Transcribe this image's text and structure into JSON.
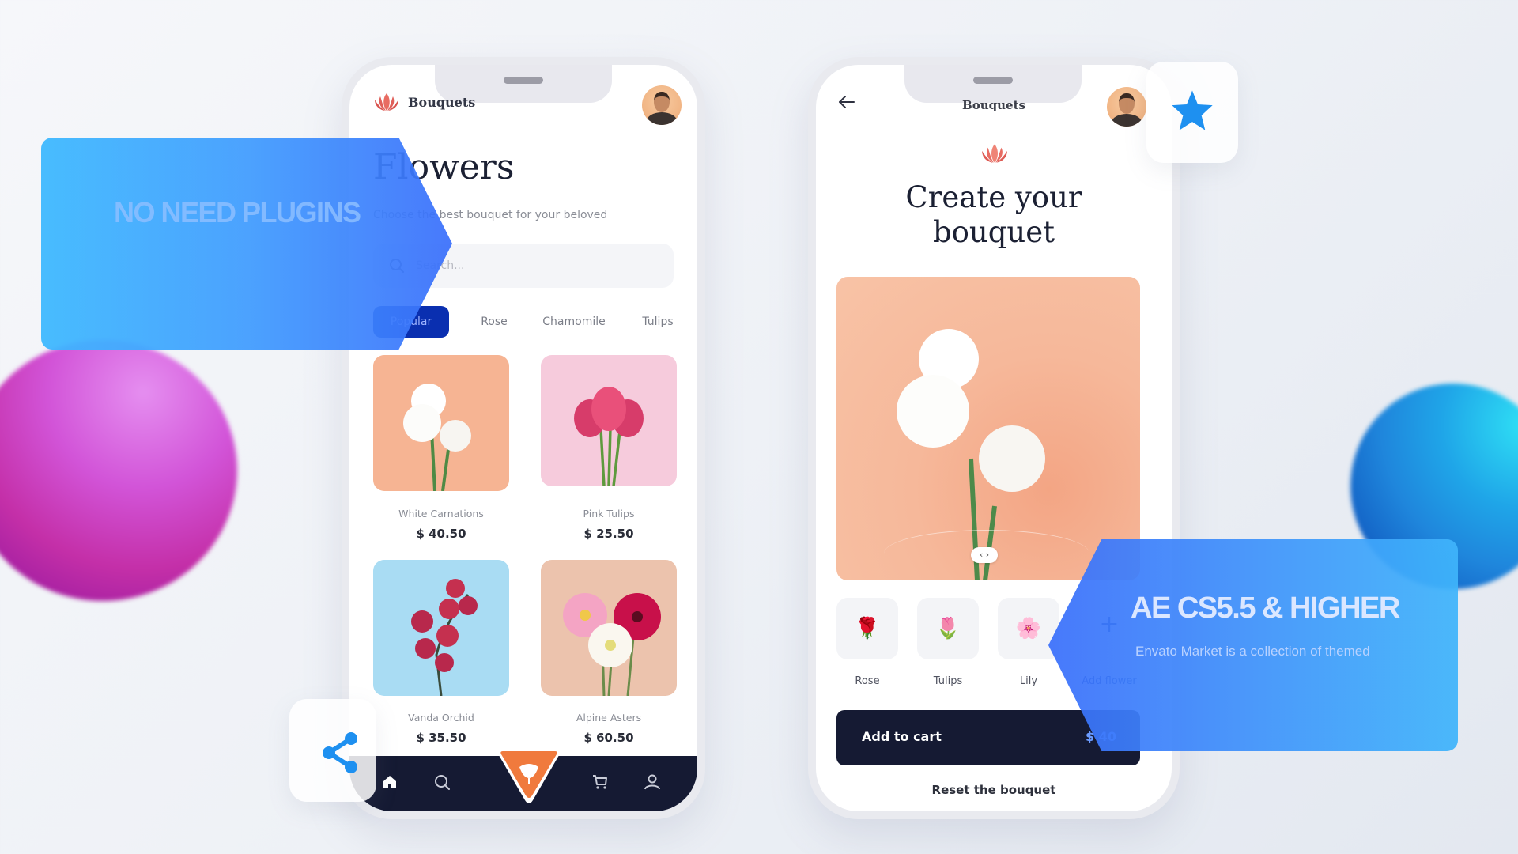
{
  "promo": {
    "left_banner": "NO NEED PLUGINS",
    "right_banner_title": "AE CS5.5 & HIGHER",
    "right_banner_subtitle": "Envato Market is a collection of themed"
  },
  "phone_list": {
    "brand": "Bouquets",
    "title": "Flowers",
    "subtitle": "Choose the best bouquet for your beloved",
    "search_placeholder": "Search...",
    "tabs": [
      {
        "label": "Popular",
        "active": true
      },
      {
        "label": "Rose",
        "active": false
      },
      {
        "label": "Chamomile",
        "active": false
      },
      {
        "label": "Tulips",
        "active": false
      }
    ],
    "products": [
      {
        "name": "White Carnations",
        "price": "$ 40.50",
        "bg": "#f6b493"
      },
      {
        "name": "Pink Tulips",
        "price": "$ 25.50",
        "bg": "#f6cbdc"
      },
      {
        "name": "Vanda Orchid",
        "price": "$ 35.50",
        "bg": "#a9dcf3"
      },
      {
        "name": "Alpine Asters",
        "price": "$ 60.50",
        "bg": "#ecc3ad"
      }
    ],
    "nav": [
      "home-icon",
      "search-icon",
      "bouquet-fab-icon",
      "cart-icon",
      "profile-icon"
    ]
  },
  "phone_builder": {
    "brand": "Bouquets",
    "title_line1": "Create your",
    "title_line2": "bouquet",
    "slider_handle": "‹ ›",
    "flower_options": [
      {
        "label": "Rose",
        "glyph": "🌹"
      },
      {
        "label": "Tulips",
        "glyph": "🌷"
      },
      {
        "label": "Lily",
        "glyph": "🌸"
      }
    ],
    "add_flower_label": "Add flower",
    "add_to_cart_label": "Add to cart",
    "total_price": "$ 40",
    "reset_label": "Reset the bouquet"
  },
  "colors": {
    "accent_blue": "#3f8ffb",
    "navy": "#151a33",
    "fab_orange": "#f07a3d",
    "lotus": "#e86c62"
  }
}
